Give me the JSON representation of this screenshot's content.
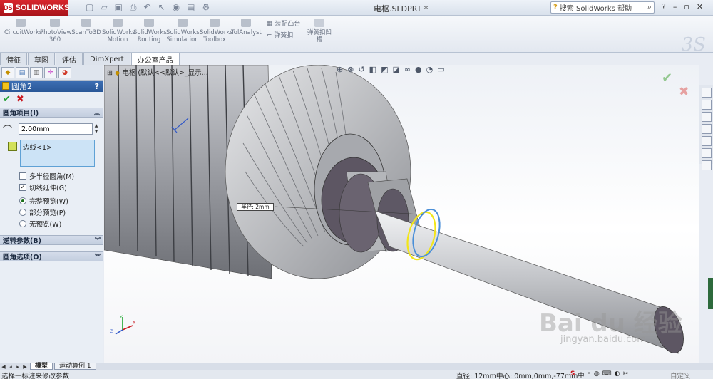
{
  "app": {
    "logo_text": "SOLIDWORKS",
    "document_title": "电枢.SLDPRT *",
    "search_placeholder": "搜索 SolidWorks 帮助"
  },
  "commands": [
    {
      "label": "CircuitWorks"
    },
    {
      "label": "PhotoView 360"
    },
    {
      "label": "ScanTo3D"
    },
    {
      "label": "SolidWorks Motion"
    },
    {
      "label": "SolidWorks Routing"
    },
    {
      "label": "SolidWorks Simulation"
    },
    {
      "label": "SolidWorks Toolbox"
    },
    {
      "label": "TolAnalyst"
    }
  ],
  "mini_commands": {
    "mount_boss": "装配凸台",
    "snap_hook": "弹簧扣",
    "snap_groove": "弹簧扣凹槽"
  },
  "tabs": [
    {
      "label": "特征"
    },
    {
      "label": "草图"
    },
    {
      "label": "评估"
    },
    {
      "label": "DimXpert"
    },
    {
      "label": "办公室产品",
      "active": true
    }
  ],
  "property_manager": {
    "title": "圆角2",
    "help": "?",
    "groups": {
      "fillet_items": "圆角项目(I)",
      "reverse_params": "逆转参数(B)",
      "fillet_options": "圆角选项(O)"
    },
    "radius_value": "2.00mm",
    "edge_selection": "边线<1>",
    "options": {
      "multi_radius": "多半径圆角(M)",
      "tangent_propagation": "切线延伸(G)",
      "full_preview": "完整预览(W)",
      "partial_preview": "部分预览(P)",
      "no_preview": "无预览(W)"
    },
    "checked": {
      "multi_radius": false,
      "tangent_propagation": true
    },
    "preview_mode": "full_preview"
  },
  "viewport": {
    "tree_label": "电枢 (默认<<默认>_显示...",
    "radius_callout": "半径: 2mm"
  },
  "watermark": {
    "logo": "Bai du 经验",
    "url": "jingyan.baidu.com"
  },
  "bottom_tabs": [
    {
      "label": "模型",
      "active": true
    },
    {
      "label": "运动算例 1"
    }
  ],
  "status": {
    "message": "选择一标注来修改参数",
    "diameter": "直径: 12mm",
    "center": "中心: 0mm,0mm,-77mm",
    "ime_s": "S",
    "ime_zh": "中",
    "custom": "自定义"
  },
  "colors": {
    "title_gradient": "#d9e1ec",
    "panel_bg": "#e9eef5",
    "pm_header": "#3d6fb4",
    "ok_green": "#21a131",
    "cancel_red": "#c8171e",
    "selection_blue": "#cce3f6",
    "part_metal": "#9b9da3",
    "part_face": "#5d5663",
    "preview_yellow": "#f2e61a"
  }
}
